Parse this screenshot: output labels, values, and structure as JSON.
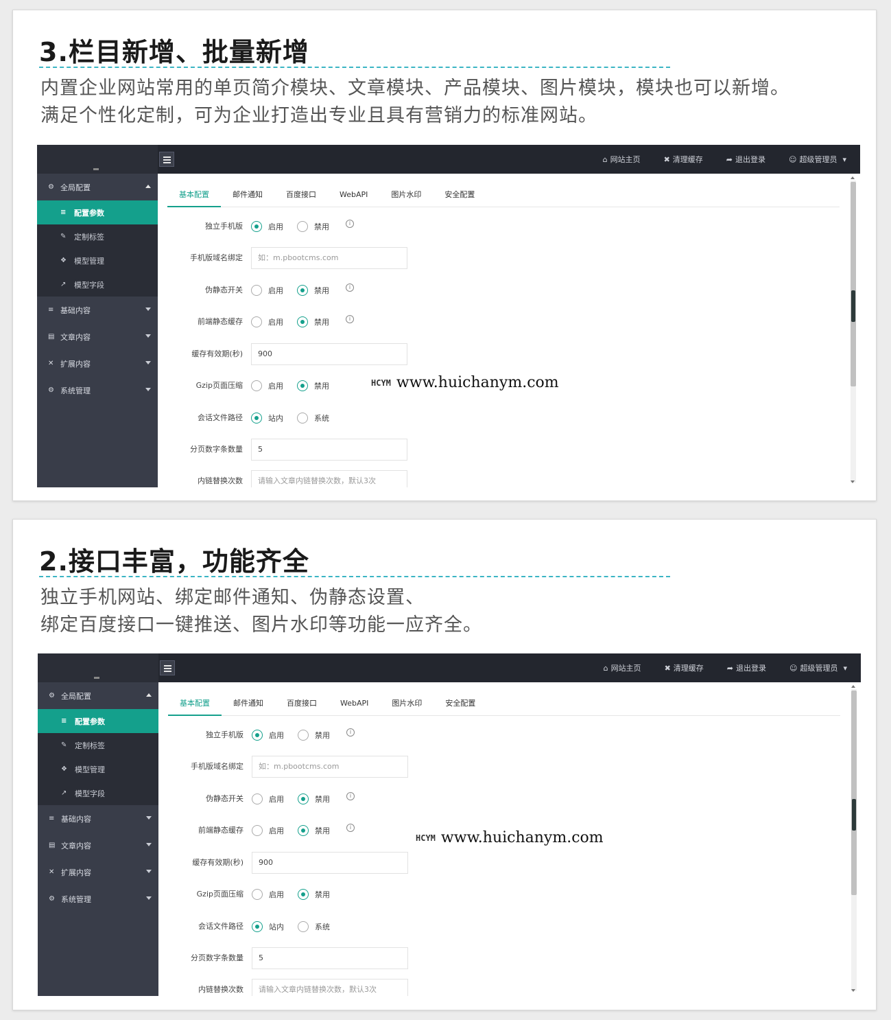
{
  "cards": [
    {
      "title": "3.栏目新增、批量新增",
      "desc_lines": [
        "内置企业网站常用的单页简介模块、文章模块、产品模块、图片模块，模块也可以新增。",
        "满足个性化定制，可为企业打造出专业且具有营销力的标准网站。"
      ]
    },
    {
      "title": "2.接口丰富，功能齐全",
      "desc_lines": [
        "独立手机网站、绑定邮件通知、伪静态设置、",
        "绑定百度接口一键推送、图片水印等功能一应齐全。"
      ]
    }
  ],
  "topbar": {
    "links": [
      {
        "icon": "home-icon",
        "glyph": "⌂",
        "label": "网站主页"
      },
      {
        "icon": "trash-icon",
        "glyph": "✖",
        "label": "清理缓存"
      },
      {
        "icon": "logout-icon",
        "glyph": "➦",
        "label": "退出登录"
      },
      {
        "icon": "user-icon",
        "glyph": "☺",
        "label": "超级管理员"
      }
    ]
  },
  "sidebar": {
    "group_open": {
      "icon": "gear-icon",
      "glyph": "⚙",
      "label": "全局配置"
    },
    "sub_items": [
      {
        "icon": "sliders-icon",
        "glyph": "≡",
        "label": "配置参数",
        "active": true
      },
      {
        "icon": "wrench-icon",
        "glyph": "✎",
        "label": "定制标签",
        "active": false
      },
      {
        "icon": "cube-icon",
        "glyph": "❖",
        "label": "模型管理",
        "active": false
      },
      {
        "icon": "external-link-icon",
        "glyph": "↗",
        "label": "模型字段",
        "active": false
      }
    ],
    "groups": [
      {
        "icon": "sliders-icon",
        "glyph": "≡",
        "label": "基础内容"
      },
      {
        "icon": "file-icon",
        "glyph": "▤",
        "label": "文章内容"
      },
      {
        "icon": "expand-icon",
        "glyph": "✕",
        "label": "扩展内容"
      },
      {
        "icon": "cog-icon",
        "glyph": "⚙",
        "label": "系统管理"
      }
    ]
  },
  "tabs": [
    "基本配置",
    "邮件通知",
    "百度接口",
    "WebAPI",
    "图片水印",
    "安全配置"
  ],
  "form": {
    "mobile_site": {
      "label": "独立手机版",
      "opt1": "启用",
      "opt2": "禁用",
      "selected": 1
    },
    "mobile_domain": {
      "label": "手机版域名绑定",
      "placeholder": "如：m.pbootcms.com"
    },
    "pseudo_static": {
      "label": "伪静态开关",
      "opt1": "启用",
      "opt2": "禁用",
      "selected": 2
    },
    "frontend_cache": {
      "label": "前端静态缓存",
      "opt1": "启用",
      "opt2": "禁用",
      "selected": 2
    },
    "cache_ttl": {
      "label": "缓存有效期(秒)",
      "value": "900"
    },
    "gzip": {
      "label": "Gzip页面压缩",
      "opt1": "启用",
      "opt2": "禁用",
      "selected": 2
    },
    "session_path": {
      "label": "会话文件路径",
      "opt1": "站内",
      "opt2": "系统",
      "selected": 1
    },
    "page_count": {
      "label": "分页数字条数量",
      "value": "5"
    },
    "replace_count": {
      "label": "内链替换次数",
      "placeholder": "请输入文章内链替换次数，默认3次"
    }
  },
  "watermark": {
    "logo": "HCYM",
    "url": "www.huichanym.com"
  }
}
